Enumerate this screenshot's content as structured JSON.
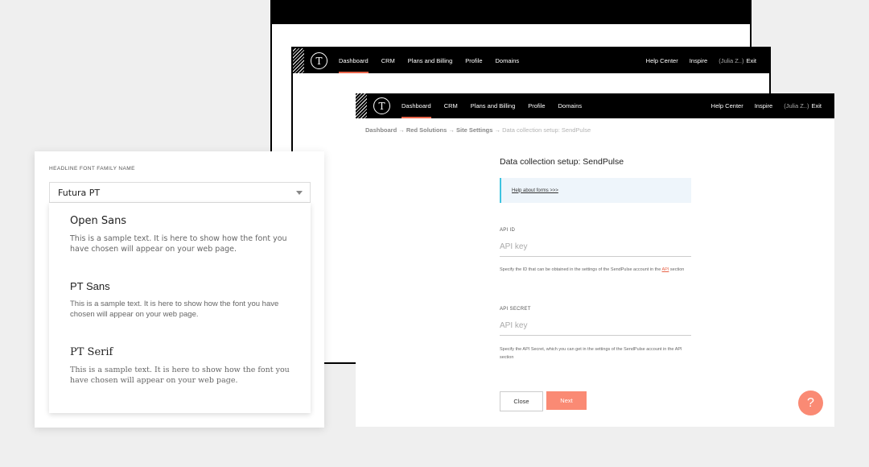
{
  "nav": {
    "items": [
      "Dashboard",
      "CRM",
      "Plans and Billing",
      "Profile",
      "Domains"
    ],
    "active": "Dashboard",
    "help_center": "Help Center",
    "inspire": "Inspire",
    "user": "(Julia Z..)",
    "exit": "Exit",
    "logo_letter": "T"
  },
  "breadcrumb": {
    "items": [
      "Dashboard",
      "Red Solutions",
      "Site Settings"
    ],
    "current": "Data collection setup: SendPulse",
    "separator": "→"
  },
  "form": {
    "title": "Data collection setup: SendPulse",
    "help_link": "Help about forms >>>",
    "api_id": {
      "label": "API ID",
      "placeholder": "API key",
      "hint_before": "Specify the ID that can be obtained in the settings of the SendPulse account in the",
      "hint_link": "API",
      "hint_after": "section"
    },
    "api_secret": {
      "label": "API SECRET",
      "placeholder": "API key",
      "hint": "Specify the API Secret, which you can get in the settings of the SendPulse account in the API section"
    },
    "close_label": "Close",
    "next_label": "Next"
  },
  "help_fab": "?",
  "font_picker": {
    "label": "HEADLINE FONT FAMILY NAME",
    "selected": "Futura PT",
    "options": [
      {
        "name": "Open Sans",
        "sample": "This is a sample text. It is here to show how the font you have chosen will appear on your web page."
      },
      {
        "name": "PT Sans",
        "sample": "This is a sample text. It is here to show how the font you have chosen will appear on your web page."
      },
      {
        "name": "PT Serif",
        "sample": "This is a sample text. It is here to show how the font you have chosen will appear on your web page."
      }
    ]
  },
  "colors": {
    "accent": "#fa8a74",
    "active_underline": "#e8654a",
    "nav_bg": "#000000",
    "help_box_bg": "#eef5fb",
    "help_box_border": "#3ec4e0"
  }
}
